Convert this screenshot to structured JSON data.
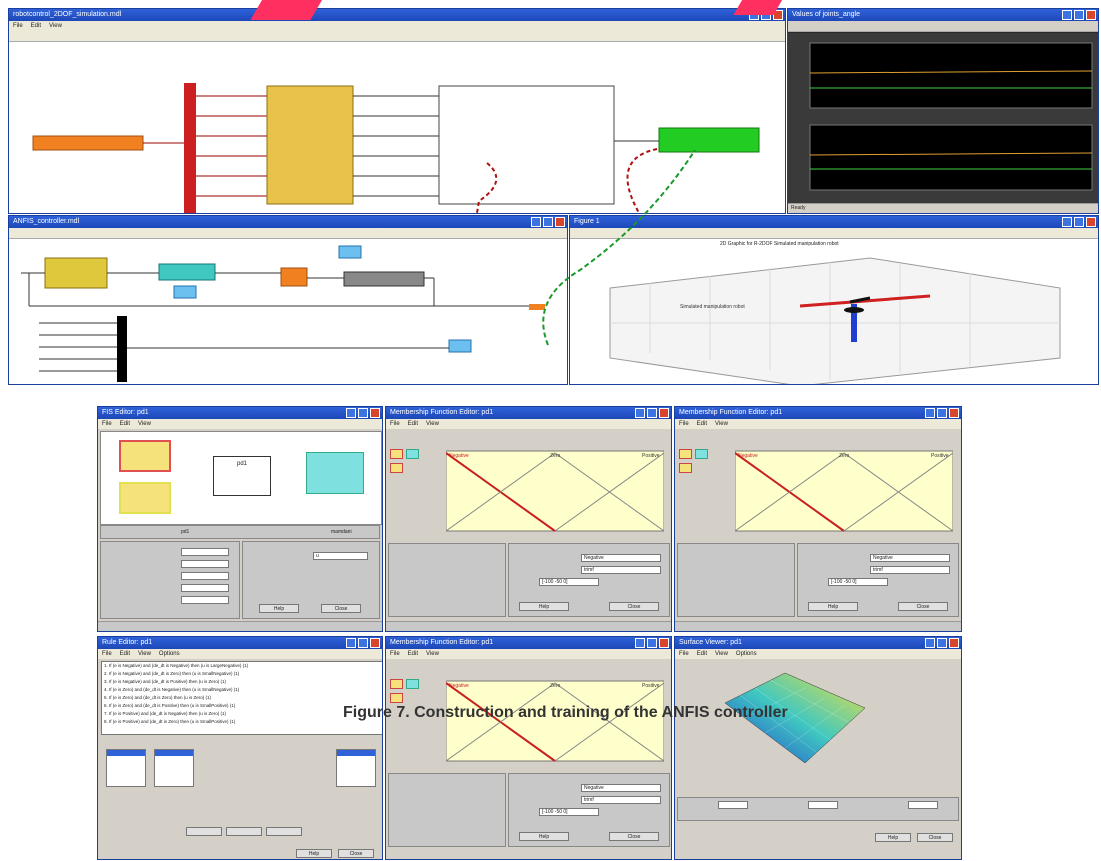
{
  "caption": "Figure 7. Construction and training of the ANFIS controller",
  "windows": {
    "simulink_top": {
      "title": "robotcontrol_2DOF_simulation.mdl"
    },
    "scope": {
      "title": "Values of joints_angle",
      "status": "Ready"
    },
    "simulink_mid": {
      "title": "ANFIS_controller.mdl"
    },
    "plot3d": {
      "title": "Figure 1",
      "plot_title": "2D Graphic for R-2DOF Simulated manipulation robot",
      "note": "Simulated manipulation robot"
    },
    "fis_editor": {
      "title": "FIS Editor: pd1",
      "fis_name": "pd1",
      "fis_type": "mamdani",
      "output_name": "u",
      "center_label": "pd1\n(mamdani)"
    },
    "mf_editor_1": {
      "title": "Membership Function Editor: pd1",
      "mf_name": "Negative",
      "mf_type": "trimf",
      "params": "[-100 -50 0]",
      "range": "[-10 10]",
      "help": "Help",
      "close": "Close"
    },
    "mf_editor_2": {
      "title": "Membership Function Editor: pd1",
      "mf_name": "Negative",
      "mf_type": "trimf",
      "params": "[-100 -50 0]",
      "range": "[-10 10]",
      "help": "Help",
      "close": "Close"
    },
    "rule_editor": {
      "title": "Rule Editor: pd1",
      "help": "Help",
      "close": "Close",
      "rules": [
        "1. If (e is Negative) and (de_dt is Negative) then (u is LargeNegative) (1)",
        "2. If (e is Negative) and (de_dt is Zero) then (u is SmallNegative) (1)",
        "3. If (e is Negative) and (de_dt is Positive) then (u is Zero) (1)",
        "4. If (e is Zero) and (de_dt is Negative) then (u is SmallNegative) (1)",
        "5. If (e is Zero) and (de_dt is Zero) then (u is Zero) (1)",
        "6. If (e is Zero) and (de_dt is Positive) then (u is SmallPositive) (1)",
        "7. If (e is Positive) and (de_dt is Negative) then (u is Zero) (1)",
        "8. If (e is Positive) and (de_dt is Zero) then (u is SmallPositive) (1)"
      ]
    },
    "mf_editor_3": {
      "title": "Membership Function Editor: pd1",
      "mf_name": "Negative",
      "mf_type": "trimf",
      "params": "[-100 -50 0]",
      "help": "Help",
      "close": "Close"
    },
    "surface_viewer": {
      "title": "Surface Viewer: pd1",
      "help": "Help",
      "close": "Close"
    }
  },
  "menu": {
    "file": "File",
    "edit": "Edit",
    "view": "View",
    "options": "Options"
  },
  "mf_labels": {
    "neg": "Negative",
    "zero": "Zero",
    "pos": "Positive"
  }
}
